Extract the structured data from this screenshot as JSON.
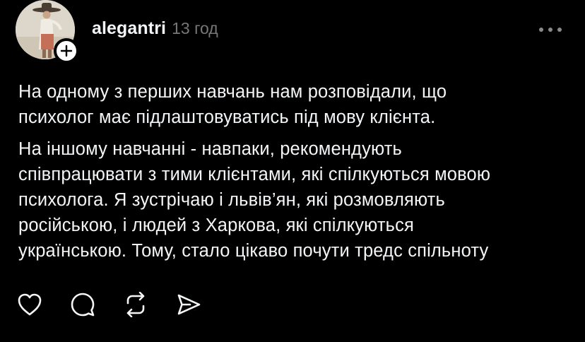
{
  "post": {
    "username": "alegantri",
    "time": "13 год",
    "paragraph_1_lines": [
      "На одному з перших навчань нам розповідали, що",
      "психолог має підлаштовуватись під мову клієнта."
    ],
    "paragraph_2_lines": [
      "На іншому навчанні - навпаки, рекомендують",
      "співпрацювати з тими клієнтами, які спілкуються мовою",
      "психолога. Я зустрічаю і львів’ян, які розмовляють",
      "російською, і людей з Харкова, які спілкуються",
      "українською. Тому, стало цікаво почути тредс спільноту"
    ]
  },
  "icons": {
    "more": "more-horizontal-icon",
    "follow": "plus-icon",
    "like": "heart-icon",
    "comment": "comment-icon",
    "repost": "repost-icon",
    "share": "send-icon"
  },
  "colors": {
    "background": "#000000",
    "text": "#f3f5f7",
    "muted": "#777777",
    "icon": "#f3f5f7"
  }
}
